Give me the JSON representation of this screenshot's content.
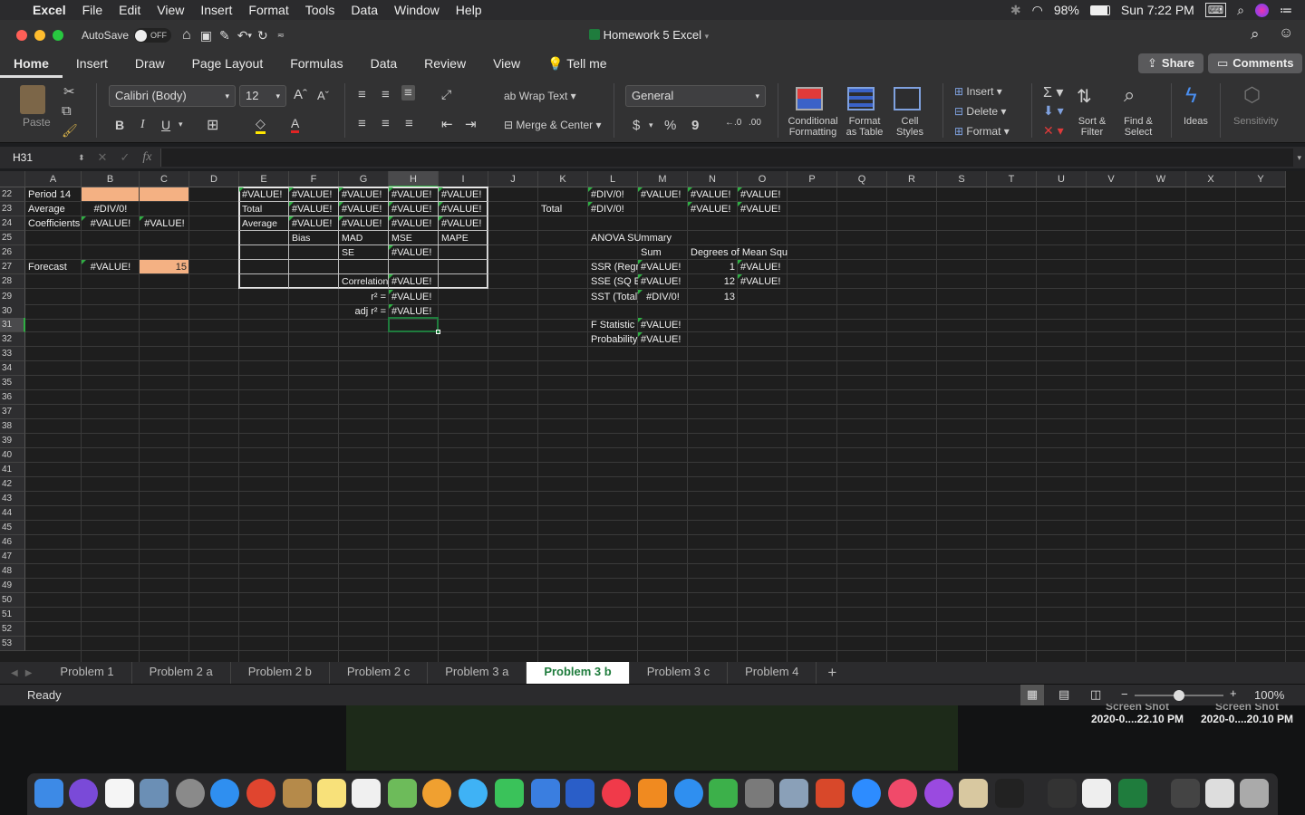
{
  "menubar": {
    "apple": "",
    "items": [
      "Excel",
      "File",
      "Edit",
      "View",
      "Insert",
      "Format",
      "Tools",
      "Data",
      "Window",
      "Help"
    ],
    "battery": "98%",
    "clock": "Sun 7:22 PM"
  },
  "titlebar": {
    "autosave": "AutoSave",
    "autosave_state": "OFF",
    "doc_title": "Homework 5 Excel"
  },
  "ribbon_tabs": [
    "Home",
    "Insert",
    "Draw",
    "Page Layout",
    "Formulas",
    "Data",
    "Review",
    "View"
  ],
  "tell_me": "Tell me",
  "share": "Share",
  "comments": "Comments",
  "ribbon": {
    "paste": "Paste",
    "font_name": "Calibri (Body)",
    "font_size": "12",
    "bold": "B",
    "italic": "I",
    "underline": "U",
    "wrap_text": "Wrap Text",
    "merge_center": "Merge & Center",
    "number_format": "General",
    "currency": "$",
    "percent": "%",
    "comma": "9",
    "conditional_formatting": "Conditional Formatting",
    "format_as_table": "Format as Table",
    "cell_styles": "Cell Styles",
    "insert": "Insert",
    "delete": "Delete",
    "format": "Format",
    "sort_filter": "Sort & Filter",
    "find_select": "Find & Select",
    "ideas": "Ideas",
    "sensitivity": "Sensitivity"
  },
  "formula_bar": {
    "name_box": "H31",
    "fx": "fx",
    "value": ""
  },
  "columns": [
    "A",
    "B",
    "C",
    "D",
    "E",
    "F",
    "G",
    "H",
    "I",
    "J",
    "K",
    "L",
    "M",
    "N",
    "O",
    "P",
    "Q",
    "R",
    "S",
    "T",
    "U",
    "V",
    "W",
    "X",
    "Y"
  ],
  "rows": [
    "22",
    "23",
    "24",
    "25",
    "26",
    "27",
    "28",
    "29",
    "30",
    "31",
    "32",
    "33",
    "34",
    "35",
    "36",
    "37",
    "38",
    "39",
    "40",
    "41",
    "42",
    "43",
    "44",
    "45",
    "46",
    "47",
    "48",
    "49",
    "50",
    "51",
    "52",
    "53"
  ],
  "cells": {
    "A22": "Period 14",
    "A23": "Average",
    "A24": "Coefficients",
    "A27": "Forecast",
    "B23": "#DIV/0!",
    "B24": "#VALUE!",
    "C24": "#VALUE!",
    "B27": "#VALUE!",
    "C27": "15",
    "E22": "#VALUE!",
    "F22": "#VALUE!",
    "G22": "#VALUE!",
    "H22": "#VALUE!",
    "I22": "#VALUE!",
    "E23": "Total",
    "F23": "#VALUE!",
    "G23": "#VALUE!",
    "H23": "#VALUE!",
    "I23": "#VALUE!",
    "E24": "Average",
    "F24": "#VALUE!",
    "G24": "#VALUE!",
    "H24": "#VALUE!",
    "I24": "#VALUE!",
    "F25": "Bias",
    "G25": "MAD",
    "H25": "MSE",
    "I25": "MAPE",
    "G26": "SE",
    "H26": "#VALUE!",
    "G28": "Correlation",
    "H28": "#VALUE!",
    "G29": "r² =",
    "H29": "#VALUE!",
    "G30": "adj r² =",
    "H30": "#VALUE!",
    "L22": "#DIV/0!",
    "M22": "#VALUE!",
    "N22": "#VALUE!",
    "O22": "#VALUE!",
    "K23": "Total",
    "L23": "#DIV/0!",
    "N23": "#VALUE!",
    "O23": "#VALUE!",
    "L25": "ANOVA SUmmary",
    "M26": "Sum",
    "N26": "Degrees of Mean Square",
    "L27": "SSR (Regr",
    "M27": "#VALUE!",
    "N27": "1",
    "O27": "#VALUE!",
    "L28": "SSE (SQ Er",
    "M28": "#VALUE!",
    "N28": "12",
    "O28": "#VALUE!",
    "L29": "SST (Total)",
    "M29": "#DIV/0!",
    "N29": "13",
    "L31": "F Statistic",
    "M31": "#VALUE!",
    "L32": "Probability",
    "M32": "#VALUE!"
  },
  "sheet_tabs": [
    "Problem 1",
    "Problem 2 a",
    "Problem 2 b",
    "Problem 2 c",
    "Problem 3 a",
    "Problem 3 b",
    "Problem 3 c",
    "Problem 4"
  ],
  "active_sheet": "Problem 3 b",
  "add_sheet": "+",
  "status": {
    "ready": "Ready",
    "zoom_minus": "−",
    "zoom_plus": "+",
    "zoom": "100%",
    "zoom_level": 0.5
  },
  "desktop": {
    "file1_top": "Screen Shot",
    "file1": "2020-0....22.10 PM",
    "file2_top": "Screen Shot",
    "file2": "2020-0....20.10 PM"
  },
  "colors": {
    "accent_green": "#1f7c3d",
    "error_triangle": "#2fae43",
    "orange_fill": "#f4b183"
  }
}
